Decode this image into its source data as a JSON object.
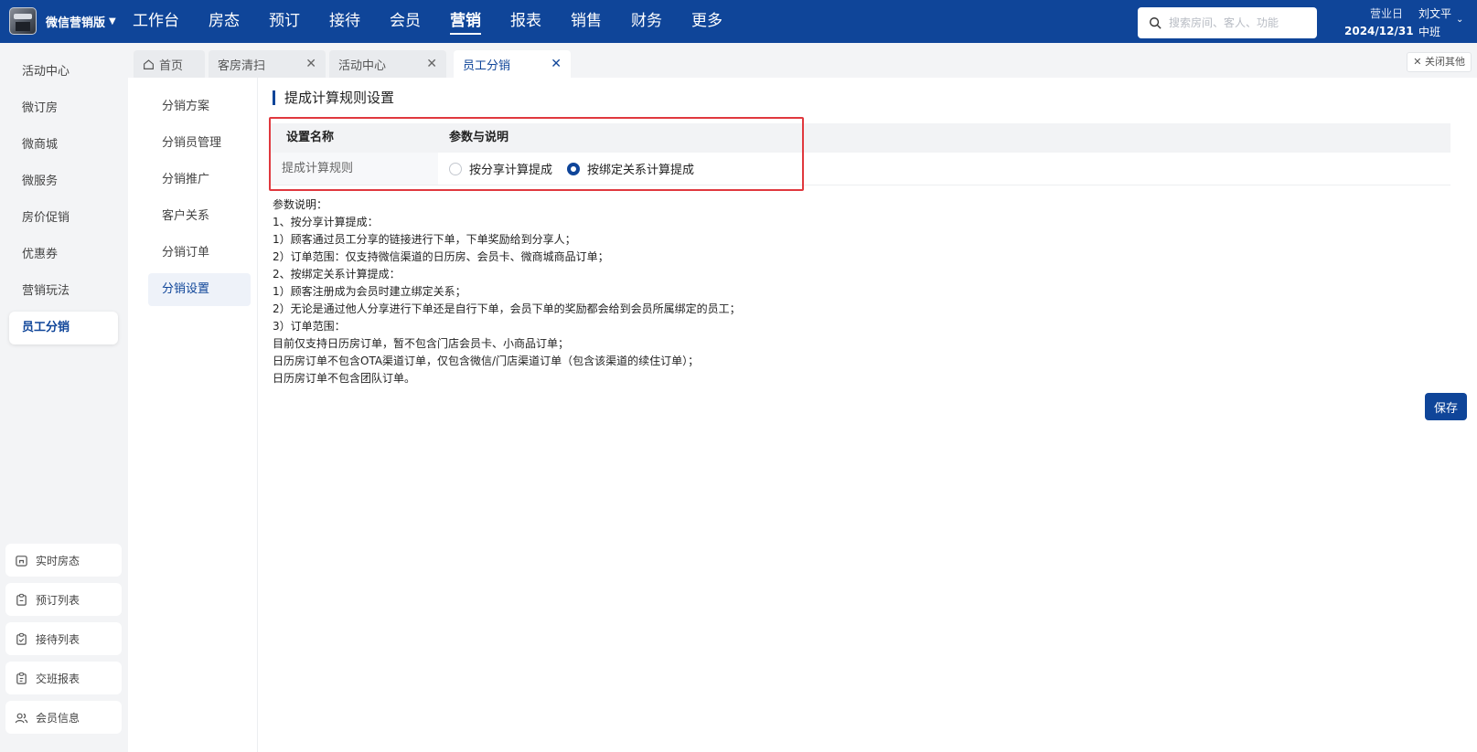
{
  "app": {
    "name": "微信营销版"
  },
  "nav": [
    "工作台",
    "房态",
    "预订",
    "接待",
    "会员",
    "营销",
    "报表",
    "销售",
    "财务",
    "更多"
  ],
  "nav_active": "营销",
  "search": {
    "placeholder": "搜索房间、客人、功能"
  },
  "business_day": {
    "label": "营业日",
    "date": "2024/12/31"
  },
  "user": {
    "name": "刘文平",
    "shift": "中班"
  },
  "sidebar": {
    "items": [
      "活动中心",
      "微订房",
      "微商城",
      "微服务",
      "房价促销",
      "优惠券",
      "营销玩法",
      "员工分销"
    ],
    "active": "员工分销",
    "quick_links": [
      "实时房态",
      "预订列表",
      "接待列表",
      "交班报表",
      "会员信息"
    ]
  },
  "tabs": {
    "items": [
      "首页",
      "客房清扫",
      "活动中心",
      "员工分销"
    ],
    "active": "员工分销",
    "close_others": "关闭其他"
  },
  "subnav": {
    "items": [
      "分销方案",
      "分销员管理",
      "分销推广",
      "客户关系",
      "分销订单",
      "分销设置"
    ],
    "active": "分销设置"
  },
  "section": {
    "title": "提成计算规则设置",
    "table": {
      "headers": [
        "设置名称",
        "参数与说明"
      ],
      "row_label": "提成计算规则",
      "options": [
        "按分享计算提成",
        "按绑定关系计算提成"
      ],
      "selected": "按绑定关系计算提成"
    },
    "description": [
      "参数说明：",
      "1、按分享计算提成：",
      "1）顾客通过员工分享的链接进行下单，下单奖励给到分享人；",
      "2）订单范围：仅支持微信渠道的日历房、会员卡、微商城商品订单；",
      "2、按绑定关系计算提成：",
      "1）顾客注册成为会员时建立绑定关系；",
      "2）无论是通过他人分享进行下单还是自行下单，会员下单的奖励都会给到会员所属绑定的员工；",
      "3）订单范围：",
      "目前仅支持日历房订单，暂不包含门店会员卡、小商品订单；",
      "日历房订单不包含OTA渠道订单，仅包含微信/门店渠道订单（包含该渠道的续住订单）；",
      "日历房订单不包含团队订单。"
    ],
    "save_label": "保存"
  },
  "colors": {
    "brand": "#0f4599",
    "highlight_box": "#e0383e"
  }
}
